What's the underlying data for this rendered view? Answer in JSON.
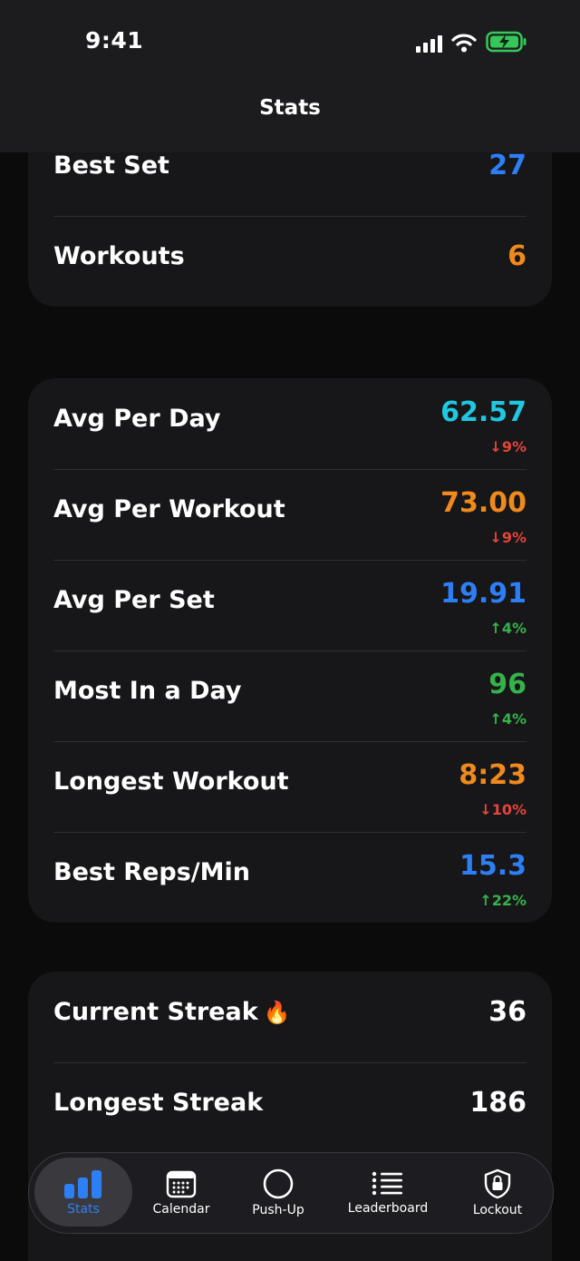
{
  "status_bar": {
    "time": "9:41"
  },
  "nav": {
    "title": "Stats"
  },
  "colors": {
    "blue": "#2d7ff6",
    "orange": "#f08a1c",
    "cyan": "#1fc8e0",
    "green": "#35b34a",
    "red": "#e5443a",
    "white": "#ffffff"
  },
  "card1": {
    "rows": [
      {
        "label": "Best Set",
        "value": "27",
        "color": "blue"
      },
      {
        "label": "Workouts",
        "value": "6",
        "color": "orange"
      }
    ]
  },
  "card2": {
    "rows": [
      {
        "label": "Avg Per Day",
        "value": "62.57",
        "color": "cyan",
        "change": "↓9%",
        "change_color": "red"
      },
      {
        "label": "Avg Per Workout",
        "value": "73.00",
        "color": "orange",
        "change": "↓9%",
        "change_color": "red"
      },
      {
        "label": "Avg Per Set",
        "value": "19.91",
        "color": "blue",
        "change": "↑4%",
        "change_color": "green"
      },
      {
        "label": "Most In a Day",
        "value": "96",
        "color": "green",
        "change": "↑4%",
        "change_color": "green"
      },
      {
        "label": "Longest Workout",
        "value": "8:23",
        "color": "orange",
        "change": "↓10%",
        "change_color": "red"
      },
      {
        "label": "Best Reps/Min",
        "value": "15.3",
        "color": "blue",
        "change": "↑22%",
        "change_color": "green"
      }
    ]
  },
  "card3": {
    "rows": [
      {
        "label": "Current Streak",
        "value": "36",
        "color": "white",
        "icon": "fire-icon"
      },
      {
        "label": "Longest Streak",
        "value": "186",
        "color": "white"
      }
    ]
  },
  "tabbar": {
    "tabs": [
      {
        "label": "Stats",
        "icon": "bar-chart-icon",
        "active": true
      },
      {
        "label": "Calendar",
        "icon": "calendar-icon"
      },
      {
        "label": "Push-Up",
        "icon": "circle-icon"
      },
      {
        "label": "Leaderboard",
        "icon": "list-icon"
      },
      {
        "label": "Lockout",
        "icon": "lock-shield-icon"
      }
    ]
  }
}
